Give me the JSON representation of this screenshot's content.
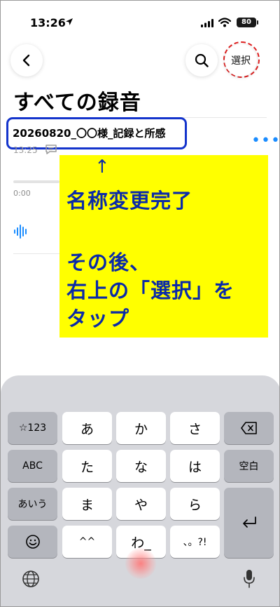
{
  "status_bar": {
    "time": "13:26",
    "battery": "80"
  },
  "header": {
    "select_label": "選択"
  },
  "page_title": "すべての録音",
  "recording": {
    "name": "20260820_〇〇様_記録と所感",
    "time": "13:25",
    "more": "•••",
    "timeline_start": "0:00"
  },
  "callout": {
    "arrow": "↑",
    "line1": "名称変更完了",
    "line2": "その後、",
    "line3": "右上の「選択」を",
    "line4": "タップ"
  },
  "keyboard": {
    "row1": [
      "☆123",
      "あ",
      "か",
      "さ"
    ],
    "row2": [
      "ABC",
      "た",
      "な",
      "は",
      "空白"
    ],
    "row3": [
      "あいう",
      "ま",
      "や",
      "ら"
    ],
    "row4": [
      "^^",
      "わ_",
      "、。?!"
    ]
  },
  "colors": {
    "highlight": "#ffff00",
    "annotation_text": "#0a2aa8",
    "accent": "#1a8cff",
    "ring": "#e02020"
  }
}
